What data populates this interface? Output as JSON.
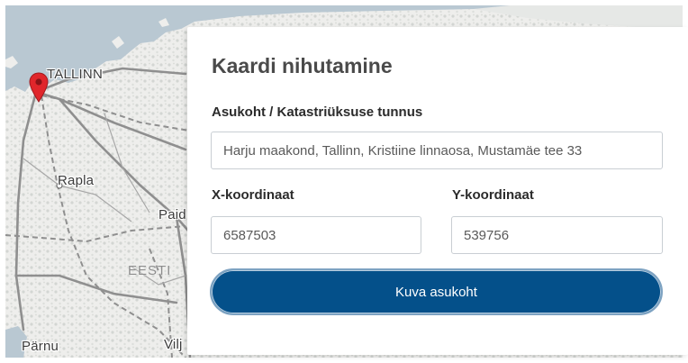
{
  "map": {
    "labels": {
      "tallinn": "TALLINN",
      "rapla": "Rapla",
      "paide": "Paid",
      "eesti": "EESTI",
      "parnu": "Pärnu",
      "viljandi": "Vilj"
    },
    "colors": {
      "sea": "#b9c8d2",
      "land": "#eeeeec",
      "road": "#8d8d8d",
      "marker": "#e0262b"
    }
  },
  "dialog": {
    "title": "Kaardi nihutamine",
    "location_label": "Asukoht / Katastriüksuse tunnus",
    "location_value": "Harju maakond, Tallinn, Kristiine linnaosa, Mustamäe tee 33",
    "x_label": "X-koordinaat",
    "x_value": "6587503",
    "y_label": "Y-koordinaat",
    "y_value": "539756",
    "submit_label": "Kuva asukoht",
    "button_color": "#04508a"
  }
}
